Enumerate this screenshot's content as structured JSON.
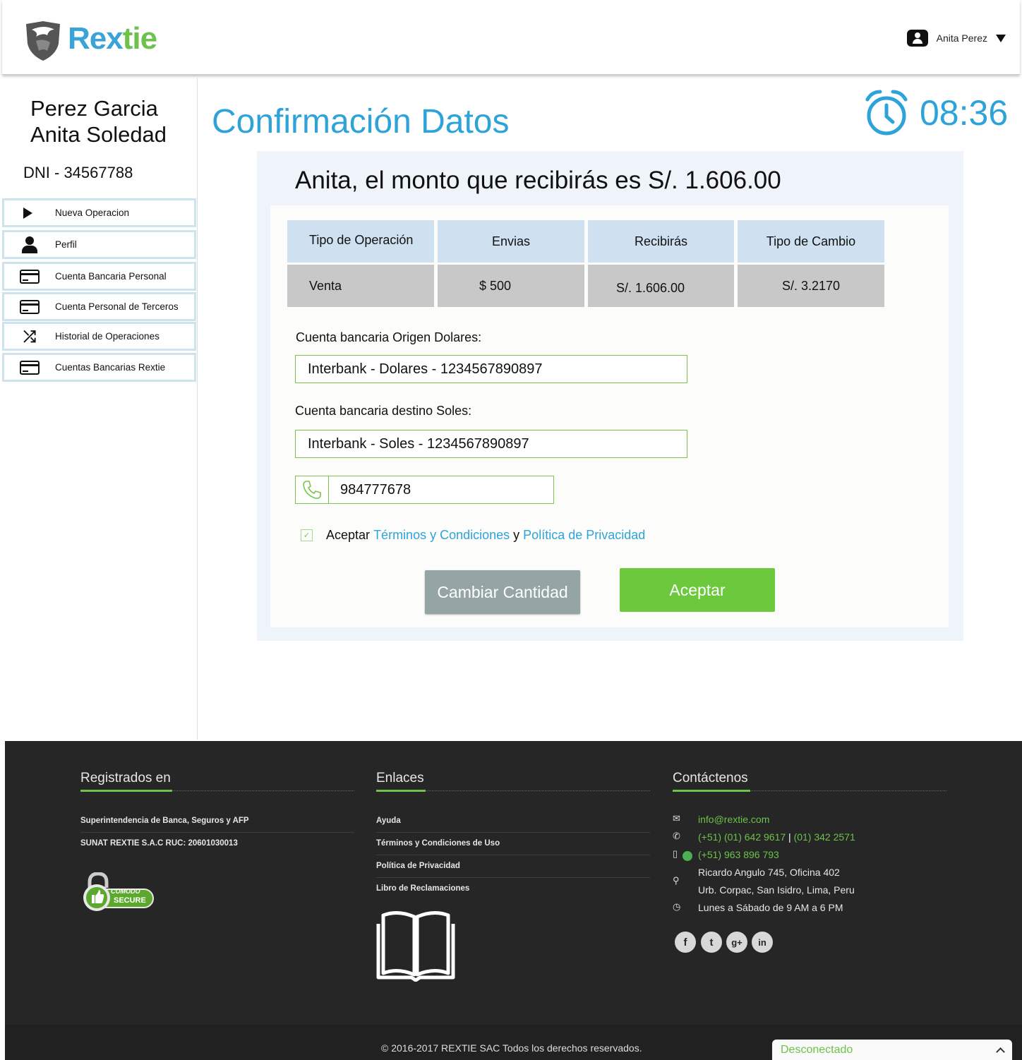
{
  "header": {
    "logo_part1": "Rex",
    "logo_part2": "tie",
    "user_name": "Anita Perez"
  },
  "sidebar": {
    "full_name_line1": "Perez Garcia",
    "full_name_line2": "Anita Soledad",
    "dni": "DNI - 34567788",
    "items": [
      {
        "label": "Nueva Operacion",
        "icon": "play-icon"
      },
      {
        "label": "Perfil",
        "icon": "person-icon"
      },
      {
        "label": "Cuenta Bancaria Personal",
        "icon": "credit-card-icon"
      },
      {
        "label": "Cuenta Personal de Terceros",
        "icon": "credit-card-icon"
      },
      {
        "label": "Historial de Operaciones",
        "icon": "shuffle-icon"
      },
      {
        "label": "Cuentas Bancarias Rextie",
        "icon": "credit-card-icon"
      }
    ]
  },
  "main": {
    "title": "Confirmación Datos",
    "timer": "08:36",
    "heading": "Anita, el monto que recibirás es S/. 1.606.00",
    "table": {
      "headers": [
        "Tipo de Operación",
        "Envias",
        "Recibirás",
        "Tipo de Cambio"
      ],
      "row": [
        "Venta",
        "$ 500",
        "S/. 1.606.00",
        "S/. 3.2170"
      ]
    },
    "origin_label": "Cuenta bancaria Origen Dolares:",
    "origin_value": "Interbank - Dolares - 1234567890897",
    "dest_label": "Cuenta bancaria destino Soles:",
    "dest_value": "Interbank - Soles - 1234567890897",
    "phone": "984777678",
    "terms_prefix": "Aceptar",
    "terms_link": "Términos y Condiciones",
    "terms_and": "y",
    "privacy_link": "Política de Privacidad",
    "terms_checked": true,
    "btn_change": "Cambiar Cantidad",
    "btn_accept": "Aceptar"
  },
  "footer": {
    "registered": {
      "title": "Registrados en",
      "items": [
        "Superintendencia de Banca, Seguros y AFP",
        "SUNAT REXTIE S.A.C RUC: 20601030013"
      ],
      "badge_line1": "COMODO",
      "badge_line2": "SECURE"
    },
    "links": {
      "title": "Enlaces",
      "items": [
        "Ayuda",
        "Términos y Condiciones de Uso",
        "Política de Privacidad",
        "Libro de Reclamaciones"
      ]
    },
    "contact": {
      "title": "Contáctenos",
      "email": "info@rextie.com",
      "phone1": "(+51) (01) 642 9617",
      "phone_sep": "|",
      "phone2": "(01) 342 2571",
      "mobile": "(+51) 963 896 793",
      "address1": "Ricardo Angulo 745, Oficina 402",
      "address2": "Urb. Corpac, San Isidro, Lima, Peru",
      "hours": "Lunes a Sábado de 9 AM a 6 PM",
      "social": [
        "facebook-icon",
        "twitter-icon",
        "google-plus-icon",
        "linkedin-icon"
      ]
    },
    "copyright": "© 2016-2017 REXTIE SAC Todos los derechos reservados.",
    "chat_status": "Desconectado"
  },
  "colors": {
    "accent_blue": "#2ea3d9",
    "accent_green": "#6cc24a",
    "footer_bg": "#262626"
  }
}
